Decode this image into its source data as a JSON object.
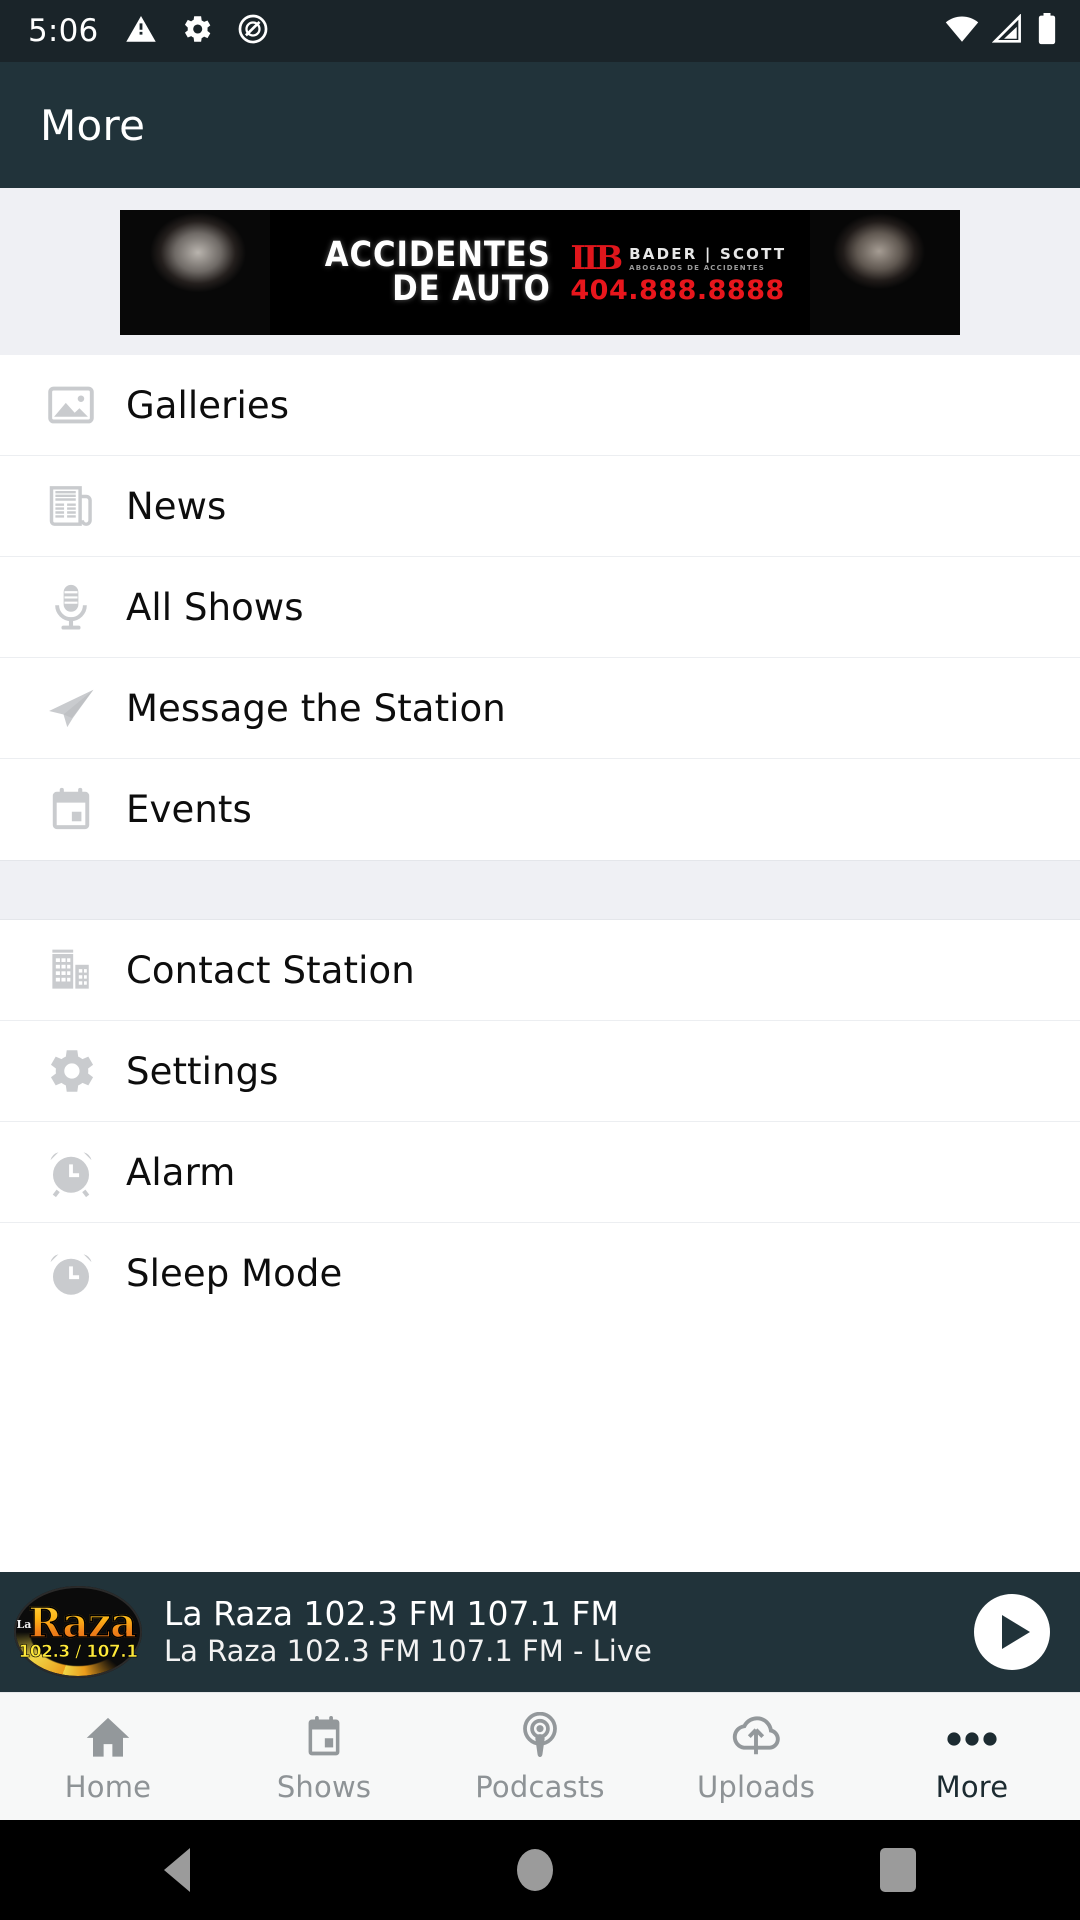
{
  "status_bar": {
    "time": "5:06",
    "left_icons": [
      "warning-triangle-icon",
      "gear-icon",
      "do-not-disturb-icon"
    ],
    "right_icons": [
      "wifi-icon",
      "cellular-signal-icon",
      "battery-icon"
    ],
    "background": "#1a2429"
  },
  "app_bar": {
    "title": "More",
    "background": "#21333a"
  },
  "ad": {
    "headline_line1": "ACCIDENTES",
    "headline_line2": "DE AUTO",
    "brand_mark": "IIB",
    "brand_name": "BADER | SCOTT",
    "brand_subtitle": "ABOGADOS DE ACCIDENTES",
    "phone": "404.888.8888",
    "accent_color": "#e8161c",
    "background": "#000000"
  },
  "menu": {
    "group_one": [
      {
        "label": "Galleries",
        "icon": "image-icon"
      },
      {
        "label": "News",
        "icon": "newspaper-icon"
      },
      {
        "label": "All Shows",
        "icon": "microphone-icon"
      },
      {
        "label": "Message the Station",
        "icon": "paper-plane-icon"
      },
      {
        "label": "Events",
        "icon": "calendar-icon"
      }
    ],
    "group_two": [
      {
        "label": "Contact Station",
        "icon": "building-icon"
      },
      {
        "label": "Settings",
        "icon": "gear-icon"
      },
      {
        "label": "Alarm",
        "icon": "alarm-clock-icon"
      },
      {
        "label": "Sleep Mode",
        "icon": "alarm-clock-icon"
      }
    ]
  },
  "player": {
    "logo_la": "La",
    "logo_name": "Raza",
    "logo_frequency": "102.3 / 107.1",
    "title": "La Raza 102.3 FM 107.1 FM",
    "subtitle": "La Raza 102.3 FM 107.1 FM - Live",
    "play_button": "play-icon",
    "background": "#21333a"
  },
  "tabs": [
    {
      "label": "Home",
      "icon": "home-icon",
      "active": false
    },
    {
      "label": "Shows",
      "icon": "calendar-icon",
      "active": false
    },
    {
      "label": "Podcasts",
      "icon": "podcast-icon",
      "active": false
    },
    {
      "label": "Uploads",
      "icon": "cloud-upload-icon",
      "active": false
    },
    {
      "label": "More",
      "icon": "ellipsis-icon",
      "active": true
    }
  ],
  "nav_bar": {
    "back": "back-triangle-icon",
    "home": "home-circle-icon",
    "recents": "recents-square-icon"
  }
}
